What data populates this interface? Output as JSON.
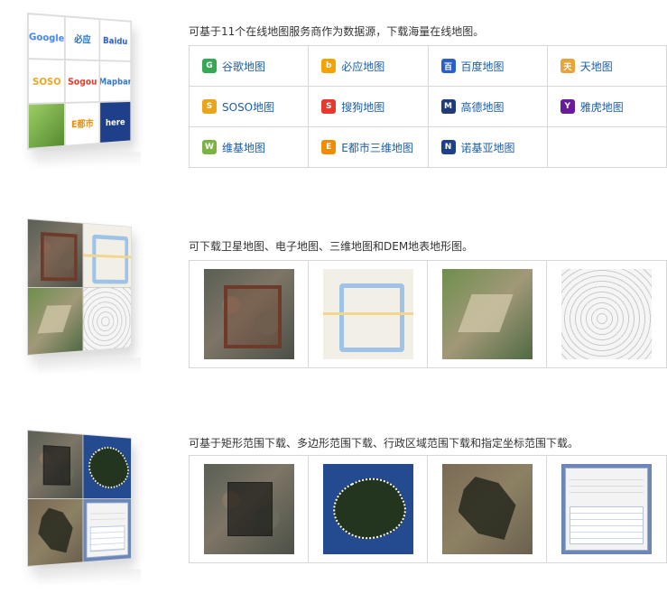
{
  "section1": {
    "description": "可基于11个在线地图服务商作为数据源，下载海量在线地图。",
    "hero_logos": [
      "Google",
      "必应",
      "Baidu",
      "SOSO",
      "Sogou",
      "Mapbar",
      "",
      "E都市",
      "here"
    ],
    "providers": [
      {
        "label": "谷歌地图",
        "icon": "google-maps-icon",
        "color": "#34a853"
      },
      {
        "label": "必应地图",
        "icon": "bing-maps-icon",
        "color": "#f4a300"
      },
      {
        "label": "百度地图",
        "icon": "baidu-maps-icon",
        "color": "#2a5ec9"
      },
      {
        "label": "天地图",
        "icon": "tianditu-icon",
        "color": "#e8a43a"
      },
      {
        "label": "SOSO地图",
        "icon": "soso-maps-icon",
        "color": "#e9a51b"
      },
      {
        "label": "搜狗地图",
        "icon": "sogou-maps-icon",
        "color": "#e53a2b"
      },
      {
        "label": "高德地图",
        "icon": "gaode-maps-icon",
        "color": "#1f3b78"
      },
      {
        "label": "雅虎地图",
        "icon": "yahoo-maps-icon",
        "color": "#6a1b9a"
      },
      {
        "label": "维基地图",
        "icon": "wiki-maps-icon",
        "color": "#7cb342"
      },
      {
        "label": "E都市三维地图",
        "icon": "edushi-maps-icon",
        "color": "#f08c00"
      },
      {
        "label": "诺基亚地图",
        "icon": "nokia-maps-icon",
        "color": "#1e3f8a"
      }
    ]
  },
  "section2": {
    "description": "可下载卫星地图、电子地图、三维地图和DEM地表地形图。",
    "images": [
      {
        "label": "satellite-map"
      },
      {
        "label": "electronic-map"
      },
      {
        "label": "3d-map"
      },
      {
        "label": "dem-terrain-map"
      }
    ]
  },
  "section3": {
    "description": "可基于矩形范围下载、多边形范围下载、行政区域范围下载和指定坐标范围下载。"
  }
}
